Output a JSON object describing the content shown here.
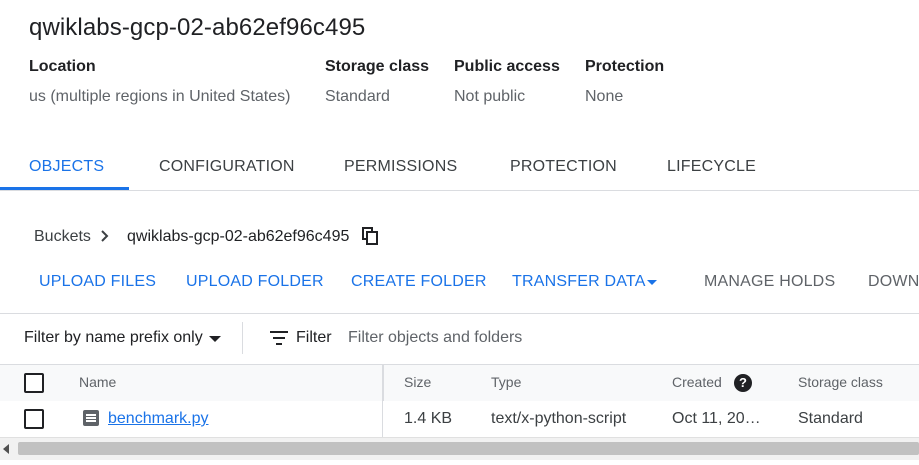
{
  "bucket": {
    "title": "qwiklabs-gcp-02-ab62ef96c495",
    "meta": [
      {
        "label": "Location",
        "value": "us (multiple regions in United States)"
      },
      {
        "label": "Storage class",
        "value": "Standard"
      },
      {
        "label": "Public access",
        "value": "Not public"
      },
      {
        "label": "Protection",
        "value": "None"
      }
    ]
  },
  "tabs": [
    {
      "label": "OBJECTS",
      "active": true
    },
    {
      "label": "CONFIGURATION"
    },
    {
      "label": "PERMISSIONS"
    },
    {
      "label": "PROTECTION"
    },
    {
      "label": "LIFECYCLE"
    }
  ],
  "breadcrumb": {
    "root": "Buckets",
    "current": "qwiklabs-gcp-02-ab62ef96c495",
    "copy_icon": "copy-icon",
    "separator_icon": "chevron-right-icon"
  },
  "actions": {
    "upload_files": "UPLOAD FILES",
    "upload_folder": "UPLOAD FOLDER",
    "create_folder": "CREATE FOLDER",
    "transfer_data": "TRANSFER DATA",
    "manage_holds": "MANAGE HOLDS",
    "download": "DOWNL"
  },
  "filter": {
    "mode": "Filter by name prefix only",
    "label": "Filter",
    "placeholder": "Filter objects and folders",
    "value": ""
  },
  "table": {
    "columns": [
      "Name",
      "Size",
      "Type",
      "Created",
      "Storage class"
    ],
    "rows": [
      {
        "name": "benchmark.py",
        "size": "1.4 KB",
        "type": "text/x-python-script",
        "created": "Oct 11, 20…",
        "storage_class": "Standard"
      }
    ]
  },
  "colors": {
    "accent": "#1a73e8",
    "text": "#202124",
    "secondary": "#5f6368"
  }
}
